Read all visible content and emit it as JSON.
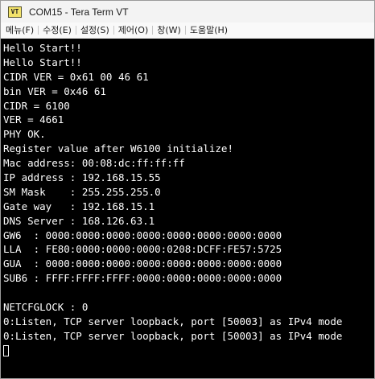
{
  "window": {
    "icon_text": "VT",
    "title": "COM15 - Tera Term VT"
  },
  "menu": [
    {
      "label": "메뉴(F)"
    },
    {
      "label": "수정(E)"
    },
    {
      "label": "설정(S)"
    },
    {
      "label": "제어(O)"
    },
    {
      "label": "창(W)"
    },
    {
      "label": "도움말(H)"
    }
  ],
  "terminal": {
    "lines": [
      "Hello Start!!",
      "Hello Start!!",
      "CIDR VER = 0x61 00 46 61",
      "bin VER = 0x46 61",
      "CIDR = 6100",
      "VER = 4661",
      "PHY OK.",
      "Register value after W6100 initialize!",
      "Mac address: 00:08:dc:ff:ff:ff",
      "IP address : 192.168.15.55",
      "SM Mask    : 255.255.255.0",
      "Gate way   : 192.168.15.1",
      "DNS Server : 168.126.63.1",
      "GW6  : 0000:0000:0000:0000:0000:0000:0000:0000",
      "LLA  : FE80:0000:0000:0000:0208:DCFF:FE57:5725",
      "GUA  : 0000:0000:0000:0000:0000:0000:0000:0000",
      "SUB6 : FFFF:FFFF:FFFF:0000:0000:0000:0000:0000",
      "",
      "NETCFGLOCK : 0",
      "0:Listen, TCP server loopback, port [50003] as IPv4 mode",
      "0:Listen, TCP server loopback, port [50003] as IPv4 mode"
    ]
  }
}
